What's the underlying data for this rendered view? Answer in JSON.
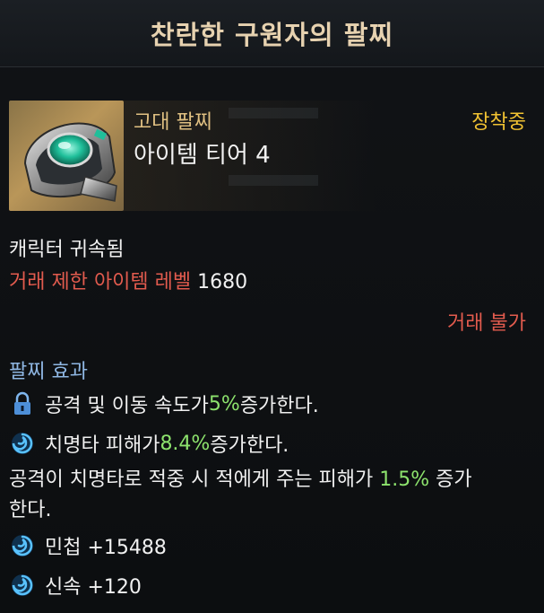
{
  "header": {
    "title": "찬란한 구원자의 팔찌"
  },
  "item": {
    "grade": "고대 팔찌",
    "tier": "아이템 티어 4",
    "equipped": "장착중",
    "icon": "bracelet-icon"
  },
  "info": {
    "bound": "캐릭터 귀속됨",
    "req_label": "거래 제한 아이템 레벨",
    "req_value": "1680",
    "trade": "거래 불가"
  },
  "effects": {
    "title": "팔찌 효과",
    "row1": {
      "icon": "lock-icon",
      "pre": "공격 및 이동 속도가 ",
      "val": "5%",
      "post": " 증가한다."
    },
    "row2": {
      "icon": "swirl-icon",
      "pre": "치명타 피해가 ",
      "val": "8.4%",
      "post": " 증가한다."
    },
    "row3": {
      "pre": "공격이 치명타로 적중 시 적에게 주는 피해가 ",
      "val": "1.5%",
      "post": " 증가",
      "line2": "한다."
    },
    "row4": {
      "icon": "swirl-icon",
      "text": "민첩 +15488"
    },
    "row5": {
      "icon": "swirl-icon",
      "text": "신속 +120"
    }
  },
  "colors": {
    "title": "#e7d2b0",
    "grade": "#e0c082",
    "equipped": "#f1c232",
    "warning": "#e25b4e",
    "section": "#8fb7e3",
    "highlight": "#8de36d"
  }
}
